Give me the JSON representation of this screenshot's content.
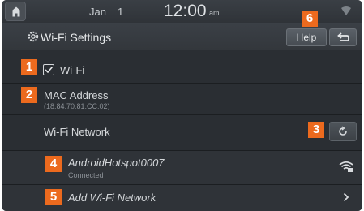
{
  "statusbar": {
    "date_month": "Jan",
    "date_day": "1",
    "time": "12:00",
    "ampm": "am"
  },
  "header": {
    "title": "Wi-Fi Settings",
    "help_label": "Help"
  },
  "callouts": [
    "1",
    "2",
    "3",
    "4",
    "5",
    "6"
  ],
  "settings": {
    "wifi_label": "Wi-Fi",
    "wifi_enabled": true,
    "mac_label": "MAC Address",
    "mac_value": "(18:84:70:81:CC:02)",
    "network_label": "Wi-Fi Network"
  },
  "networks": [
    {
      "name": "AndroidHotspot0007",
      "status": "Connected"
    }
  ],
  "add_network_label": "Add Wi-Fi Network",
  "colors": {
    "accent": "#ec6a1e",
    "background": "#2a2e33"
  }
}
